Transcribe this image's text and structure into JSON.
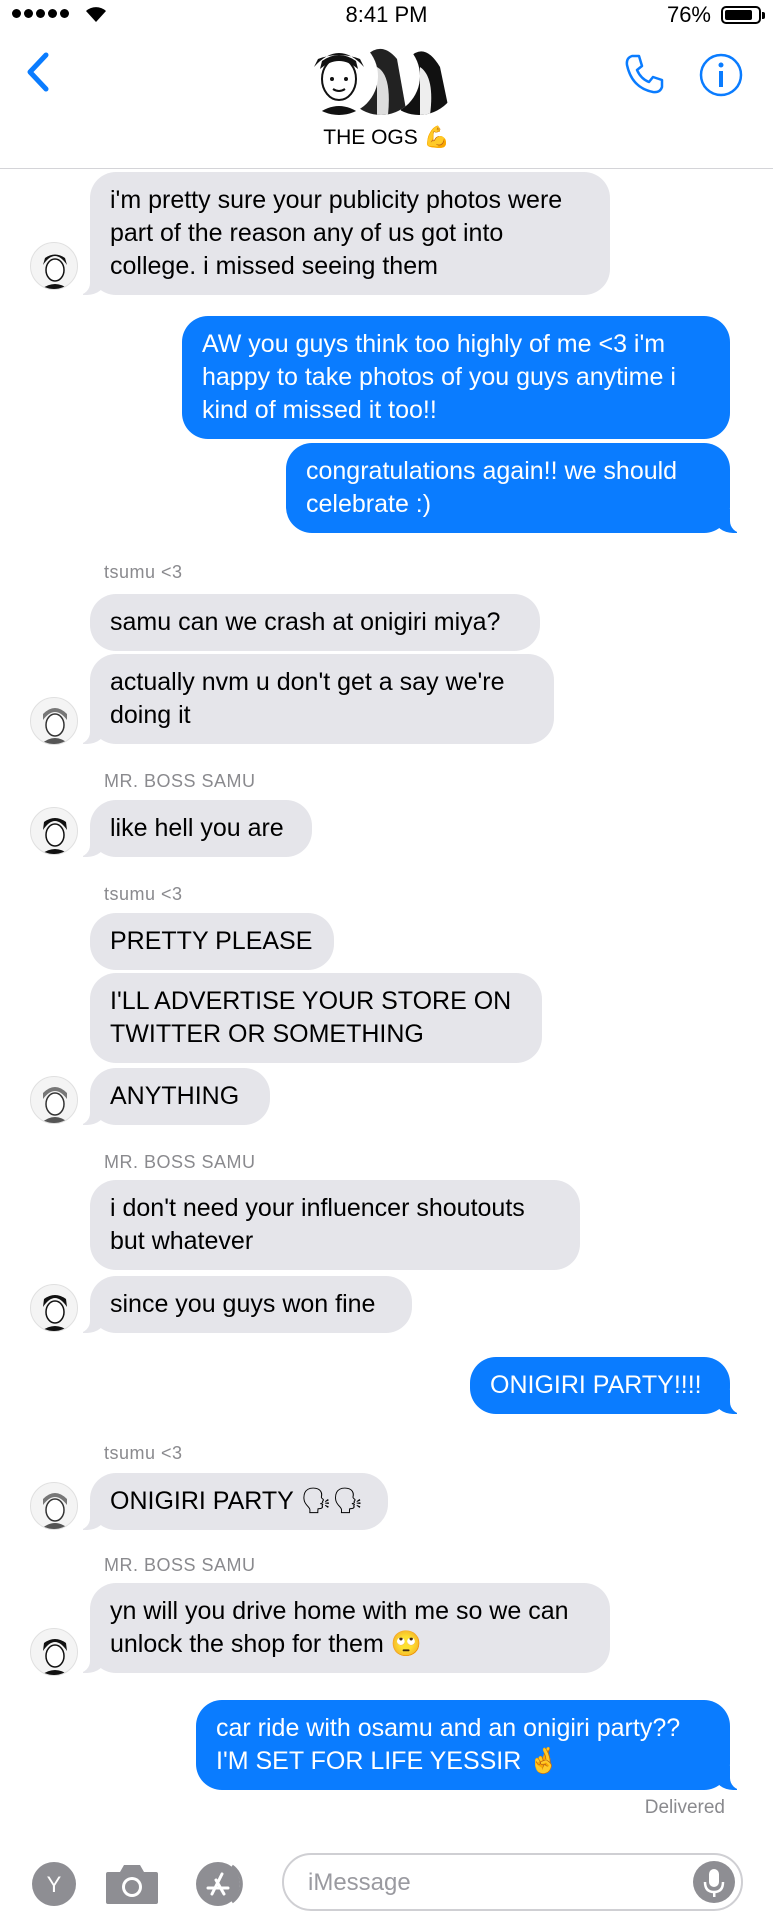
{
  "status_bar": {
    "time": "8:41 PM",
    "battery": "76%"
  },
  "header": {
    "group_name": "THE OGS 💪"
  },
  "messages": {
    "m1": "i'm pretty sure your publicity photos were part of the reason any of us got into college. i missed seeing them",
    "m2": "AW you guys think too highly of me <3 i'm happy to take photos of you guys anytime i kind of missed it too!!",
    "m3": "congratulations again!! we should celebrate :)",
    "s1": "tsumu <3",
    "m4": "samu can we crash at onigiri miya?",
    "m5": "actually nvm u don't get a say we're doing it",
    "s2": "MR. BOSS SAMU",
    "m6": "like hell you are",
    "s3": "tsumu <3",
    "m7": "PRETTY PLEASE",
    "m8": "I'LL ADVERTISE YOUR STORE ON TWITTER OR SOMETHING",
    "m9": "ANYTHING",
    "s4": "MR. BOSS SAMU",
    "m10": "i don't need your influencer shoutouts but whatever",
    "m11": "since you guys won fine",
    "m12": "ONIGIRI PARTY!!!!",
    "s5": "tsumu <3",
    "m13": "ONIGIRI PARTY 🗣🗣",
    "s6": "MR. BOSS SAMU",
    "m14": "yn will you drive home with me so we can unlock the shop for them 🙄",
    "m15": "car ride with osamu and an onigiri party?? I'M SET FOR LIFE YESSIR 🤞"
  },
  "delivered_label": "Delivered",
  "input": {
    "placeholder": "iMessage",
    "apps_letter": "Y"
  },
  "colors": {
    "outgoing": "#0a7cff",
    "incoming": "#e5e5ea",
    "accent": "#0a7cff"
  },
  "icons": [
    "back-chevron-icon",
    "phone-icon",
    "info-icon",
    "camera-icon",
    "app-store-icon",
    "microphone-icon",
    "wifi-icon",
    "battery-icon"
  ]
}
